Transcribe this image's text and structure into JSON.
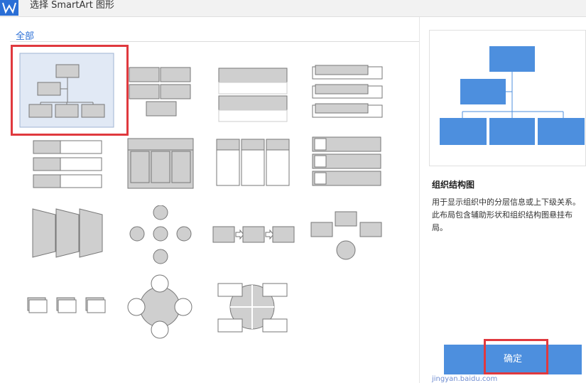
{
  "window": {
    "title": "选择 SmartArt 图形",
    "app_icon": "wps-writer-icon"
  },
  "category": {
    "label": "全部"
  },
  "gallery": {
    "items": [
      {
        "name": "organization-chart",
        "selected": true
      },
      {
        "name": "grid-blocks"
      },
      {
        "name": "text-list"
      },
      {
        "name": "stacked-list"
      },
      {
        "name": "bullet-list"
      },
      {
        "name": "table-hierarchy"
      },
      {
        "name": "column-list"
      },
      {
        "name": "picture-list"
      },
      {
        "name": "trapezoid-list"
      },
      {
        "name": "radial-arrows"
      },
      {
        "name": "process-flow"
      },
      {
        "name": "converging-arrows"
      },
      {
        "name": "picture-process"
      },
      {
        "name": "radial-cycle"
      },
      {
        "name": "matrix-cycle"
      }
    ]
  },
  "preview": {
    "title": "组织结构图",
    "description": "用于显示组织中的分层信息或上下级关系。此布局包含辅助形状和组织结构图悬挂布局。"
  },
  "ok_button": {
    "label": "确定"
  },
  "colors": {
    "accent": "#4d8fde",
    "highlight": "#e0393e",
    "thumb_fill": "#cfcfcf"
  },
  "watermark": {
    "text": "jingyan.baidu.com"
  }
}
